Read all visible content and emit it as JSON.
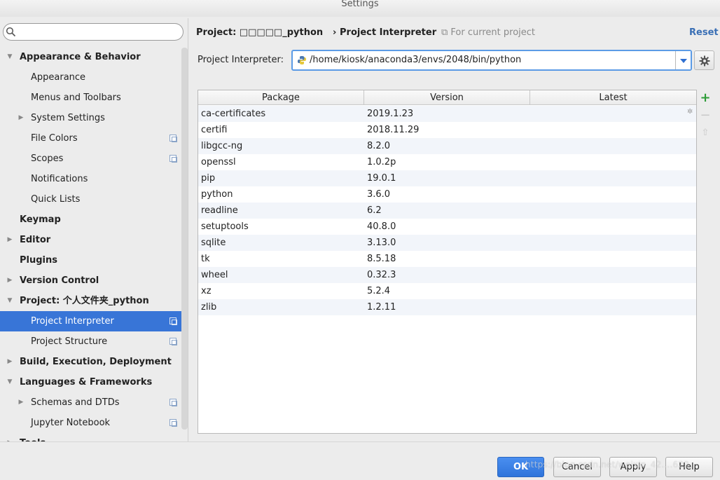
{
  "window": {
    "title": "Settings"
  },
  "search": {
    "value": "",
    "placeholder": ""
  },
  "sidebar": {
    "items": [
      {
        "label": "Appearance & Behavior",
        "level": 0,
        "bold": true,
        "arrow": "down"
      },
      {
        "label": "Appearance",
        "level": 1
      },
      {
        "label": "Menus and Toolbars",
        "level": 1
      },
      {
        "label": "System Settings",
        "level": 1,
        "arrow": "right"
      },
      {
        "label": "File Colors",
        "level": 1,
        "copy": true
      },
      {
        "label": "Scopes",
        "level": 1,
        "copy": true
      },
      {
        "label": "Notifications",
        "level": 1
      },
      {
        "label": "Quick Lists",
        "level": 1
      },
      {
        "label": "Keymap",
        "level": 0,
        "bold": true
      },
      {
        "label": "Editor",
        "level": 0,
        "bold": true,
        "arrow": "right"
      },
      {
        "label": "Plugins",
        "level": 0,
        "bold": true
      },
      {
        "label": "Version Control",
        "level": 0,
        "bold": true,
        "arrow": "right"
      },
      {
        "label": "Project: 个人文件夹_python",
        "level": 0,
        "bold": true,
        "arrow": "down"
      },
      {
        "label": "Project Interpreter",
        "level": 1,
        "copy": true,
        "selected": true
      },
      {
        "label": "Project Structure",
        "level": 1,
        "copy": true
      },
      {
        "label": "Build, Execution, Deployment",
        "level": 0,
        "bold": true,
        "arrow": "right"
      },
      {
        "label": "Languages & Frameworks",
        "level": 0,
        "bold": true,
        "arrow": "down"
      },
      {
        "label": "Schemas and DTDs",
        "level": 1,
        "arrow": "right",
        "copy": true
      },
      {
        "label": "Jupyter Notebook",
        "level": 1,
        "copy": true
      },
      {
        "label": "Tools",
        "level": 0,
        "bold": true,
        "arrow": "right"
      }
    ]
  },
  "header": {
    "project": "Project: □□□□□_python",
    "separator": "›",
    "page": "Project Interpreter",
    "scope": "For current project",
    "reset_label": "Reset"
  },
  "interpreter": {
    "label": "Project Interpreter:",
    "path": "/home/kiosk/anaconda3/envs/2048/bin/python"
  },
  "packages": {
    "columns": [
      "Package",
      "Version",
      "Latest"
    ],
    "rows": [
      {
        "package": "ca-certificates",
        "version": "2019.1.23",
        "latest": ""
      },
      {
        "package": "certifi",
        "version": "2018.11.29",
        "latest": ""
      },
      {
        "package": "libgcc-ng",
        "version": "8.2.0",
        "latest": ""
      },
      {
        "package": "openssl",
        "version": "1.0.2p",
        "latest": ""
      },
      {
        "package": "pip",
        "version": "19.0.1",
        "latest": ""
      },
      {
        "package": "python",
        "version": "3.6.0",
        "latest": ""
      },
      {
        "package": "readline",
        "version": "6.2",
        "latest": ""
      },
      {
        "package": "setuptools",
        "version": "40.8.0",
        "latest": ""
      },
      {
        "package": "sqlite",
        "version": "3.13.0",
        "latest": ""
      },
      {
        "package": "tk",
        "version": "8.5.18",
        "latest": ""
      },
      {
        "package": "wheel",
        "version": "0.32.3",
        "latest": ""
      },
      {
        "package": "xz",
        "version": "5.2.4",
        "latest": ""
      },
      {
        "package": "zlib",
        "version": "1.2.11",
        "latest": ""
      }
    ]
  },
  "tools": {
    "add": "+",
    "remove": "−",
    "upgrade": "⇧"
  },
  "footer": {
    "ok_label": "OK",
    "cancel_label": "Cancel",
    "apply_label": "Apply",
    "help_label": "Help"
  },
  "watermark": "https://blog.csdn.net/weixin_42....622"
}
